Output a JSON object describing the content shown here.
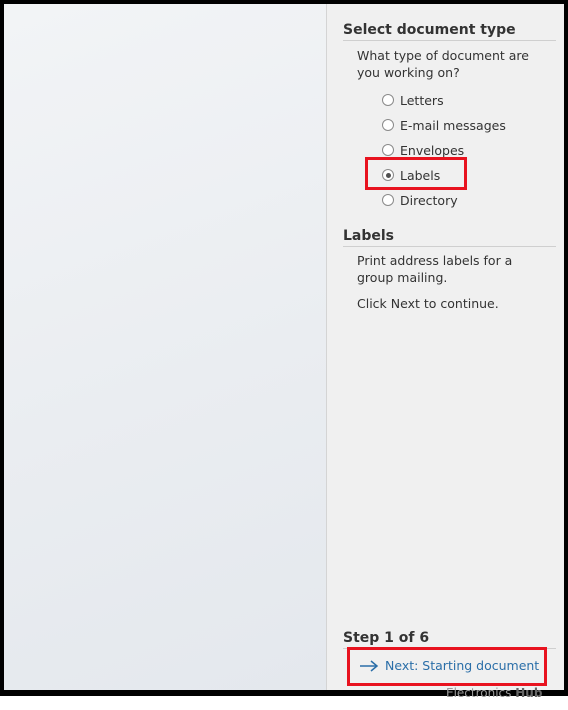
{
  "pane": {
    "section_title": "Select document type",
    "question": "What type of document are you working on?",
    "options": [
      {
        "label": "Letters",
        "checked": false
      },
      {
        "label": "E-mail messages",
        "checked": false
      },
      {
        "label": "Envelopes",
        "checked": false
      },
      {
        "label": "Labels",
        "checked": true
      },
      {
        "label": "Directory",
        "checked": false
      }
    ],
    "labels_section_title": "Labels",
    "labels_description": "Print address labels for a group mailing.",
    "labels_instruction": "Click Next to continue.",
    "step_label": "Step 1 of 6",
    "next_link": "Next: Starting document"
  },
  "watermark": {
    "text": "Electronics",
    "bold": "Hub"
  },
  "colors": {
    "highlight": "#e8131f",
    "link": "#2a6ea8"
  }
}
